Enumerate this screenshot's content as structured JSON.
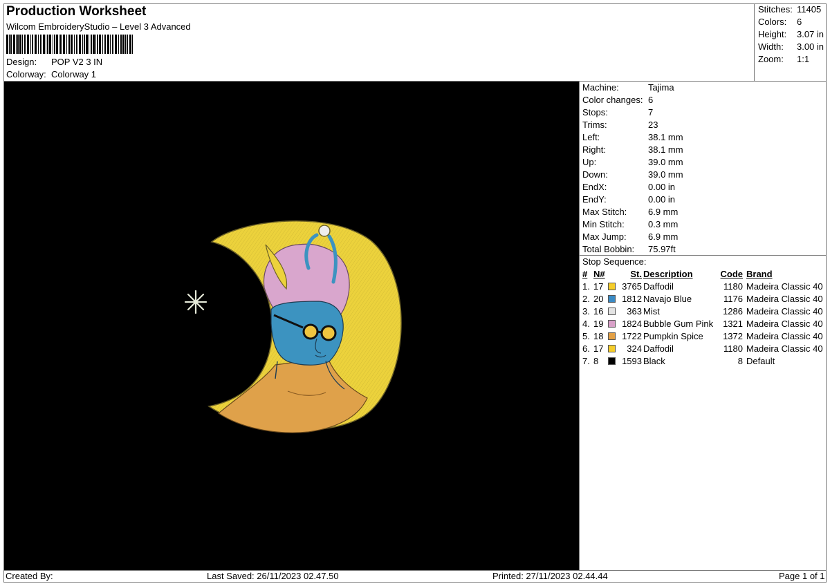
{
  "header": {
    "title": "Production Worksheet",
    "subtitle": "Wilcom EmbroideryStudio – Level 3 Advanced",
    "design_label": "Design:",
    "design_value": "POP V2 3 IN",
    "colorway_label": "Colorway:",
    "colorway_value": "Colorway 1"
  },
  "stats": [
    {
      "label": "Stitches:",
      "value": "11405"
    },
    {
      "label": "Colors:",
      "value": "6"
    },
    {
      "label": "Height:",
      "value": "3.07 in"
    },
    {
      "label": "Width:",
      "value": "3.00 in"
    },
    {
      "label": "Zoom:",
      "value": "1:1"
    }
  ],
  "machine_info": [
    {
      "label": "Machine:",
      "value": "Tajima"
    },
    {
      "label": "Color changes:",
      "value": "6"
    },
    {
      "label": "Stops:",
      "value": "7"
    },
    {
      "label": "Trims:",
      "value": "23"
    },
    {
      "label": "Left:",
      "value": "38.1 mm"
    },
    {
      "label": "Right:",
      "value": "38.1 mm"
    },
    {
      "label": "Up:",
      "value": "39.0 mm"
    },
    {
      "label": "Down:",
      "value": "39.0 mm"
    },
    {
      "label": "EndX:",
      "value": "0.00 in"
    },
    {
      "label": "EndY:",
      "value": "0.00 in"
    },
    {
      "label": "Max Stitch:",
      "value": "6.9 mm"
    },
    {
      "label": "Min Stitch:",
      "value": "0.3 mm"
    },
    {
      "label": "Max Jump:",
      "value": "6.9 mm"
    },
    {
      "label": "Total Bobbin:",
      "value": "75.97ft"
    }
  ],
  "stop_sequence": {
    "title": "Stop Sequence:",
    "headers": {
      "idx": "#",
      "n": "N#",
      "st": "St.",
      "desc": "Description",
      "code": "Code",
      "brand": "Brand"
    },
    "rows": [
      {
        "idx": "1.",
        "n": "17",
        "color": "#f5cd2a",
        "st": "3765",
        "desc": "Daffodil",
        "code": "1180",
        "brand": "Madeira Classic 40"
      },
      {
        "idx": "2.",
        "n": "20",
        "color": "#3a8ac4",
        "st": "1812",
        "desc": "Navajo Blue",
        "code": "1176",
        "brand": "Madeira Classic 40"
      },
      {
        "idx": "3.",
        "n": "16",
        "color": "#e4e4e4",
        "st": "363",
        "desc": "Mist",
        "code": "1286",
        "brand": "Madeira Classic 40"
      },
      {
        "idx": "4.",
        "n": "19",
        "color": "#d9a1c9",
        "st": "1824",
        "desc": "Bubble Gum Pink",
        "code": "1321",
        "brand": "Madeira Classic 40"
      },
      {
        "idx": "5.",
        "n": "18",
        "color": "#e3a045",
        "st": "1722",
        "desc": "Pumpkin Spice",
        "code": "1372",
        "brand": "Madeira Classic 40"
      },
      {
        "idx": "6.",
        "n": "17",
        "color": "#f5cd2a",
        "st": "324",
        "desc": "Daffodil",
        "code": "1180",
        "brand": "Madeira Classic 40"
      },
      {
        "idx": "7.",
        "n": "8",
        "color": "#000000",
        "st": "1593",
        "desc": "Black",
        "code": "8",
        "brand": "Default"
      }
    ]
  },
  "footer": {
    "created_by": "Created By:",
    "last_saved": "Last Saved: 26/11/2023 02.47.50",
    "printed": "Printed: 27/11/2023 02.44.44",
    "page": "Page 1 of 1"
  },
  "colors": {
    "canvas_bg": "#000000",
    "moon": "#ecd23c",
    "face": "#3c93c0",
    "hair": "#d9a6cd",
    "body": "#dfa14a",
    "star": "#e6ead9"
  }
}
